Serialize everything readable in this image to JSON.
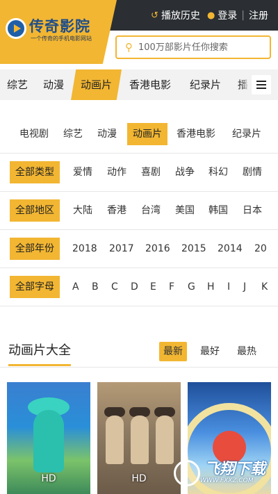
{
  "header": {
    "logo_title": "传奇影院",
    "logo_slogan": "一个传奇的手机电影网站",
    "history_label": "播放历史",
    "login_label": "登录",
    "divider": "|",
    "register_label": "注册",
    "search_placeholder": "100万部影片任你搜索"
  },
  "catnav": {
    "items": [
      "综艺",
      "动漫",
      "动画片",
      "香港电影",
      "纪录片",
      "播"
    ],
    "active": "动画片"
  },
  "filters": {
    "channels": [
      "电视剧",
      "综艺",
      "动漫",
      "动画片",
      "香港电影",
      "纪录片"
    ],
    "type": {
      "label": "全部类型",
      "options": [
        "爱情",
        "动作",
        "喜剧",
        "战争",
        "科幻",
        "剧情"
      ]
    },
    "region": {
      "label": "全部地区",
      "options": [
        "大陆",
        "香港",
        "台湾",
        "美国",
        "韩国",
        "日本"
      ]
    },
    "year": {
      "label": "全部年份",
      "options": [
        "2018",
        "2017",
        "2016",
        "2015",
        "2014",
        "20"
      ]
    },
    "letter": {
      "label": "全部字母",
      "options": [
        "A",
        "B",
        "C",
        "D",
        "E",
        "F",
        "G",
        "H",
        "I",
        "J",
        "K"
      ]
    }
  },
  "section": {
    "title": "动画片大全",
    "sort": [
      "最新",
      "最好",
      "最热"
    ],
    "active_sort": "最新"
  },
  "posters": [
    {
      "badge": "HD"
    },
    {
      "badge": "HD"
    },
    {
      "badge": ""
    }
  ],
  "watermark": {
    "title": "飞翔下载",
    "url": "WWW.FXXZ.COM"
  },
  "colors": {
    "accent": "#f2b632",
    "topbar": "#2b2f33",
    "logo_blue": "#1f4e8a"
  }
}
